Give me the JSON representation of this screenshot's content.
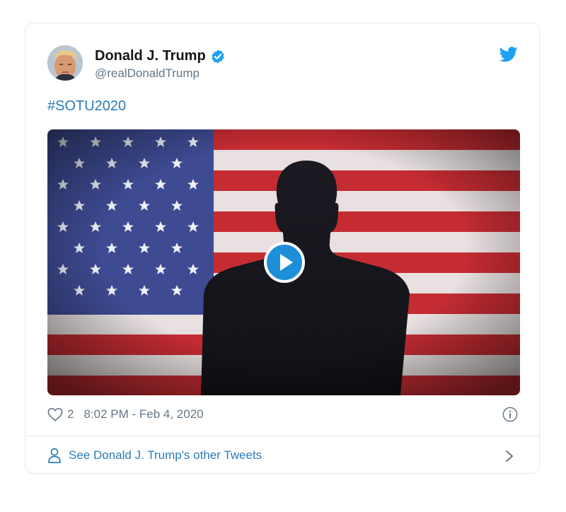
{
  "tweet": {
    "author_name": "Donald J. Trump",
    "handle": "@realDonaldTrump",
    "text": "#SOTU2020",
    "like_count": "2",
    "timestamp": "8:02 PM - Feb 4, 2020",
    "more_tweets_label": "See Donald J. Trump's other Tweets"
  },
  "icons": {
    "verified": "verified-badge-icon",
    "logo": "twitter-bird-icon",
    "play": "play-icon",
    "like": "heart-icon",
    "info": "info-icon",
    "profile": "person-icon",
    "next": "chevron-right-icon"
  },
  "colors": {
    "brand_blue": "#1da1f2",
    "link_blue": "#2b7bb9",
    "name_text": "#14171a",
    "secondary_text": "#657786",
    "border": "#e1e8ed"
  }
}
